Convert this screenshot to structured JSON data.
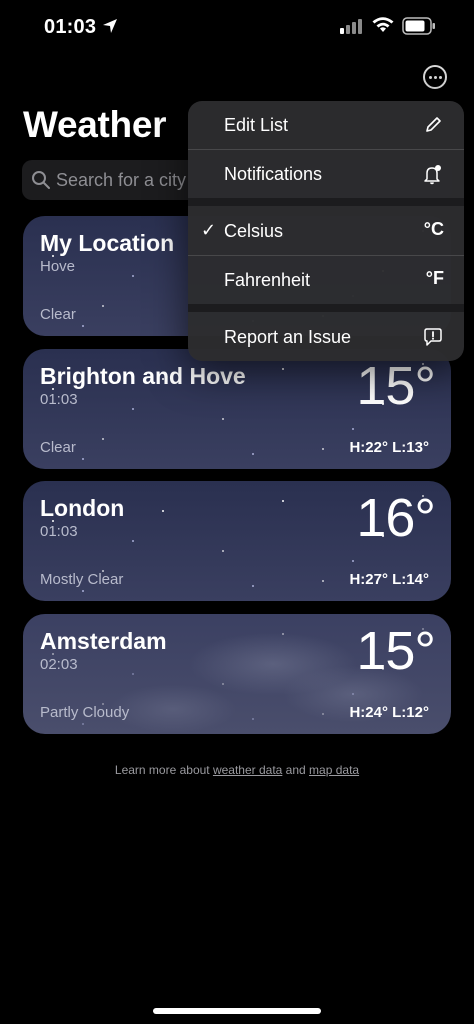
{
  "status_bar": {
    "time": "01:03"
  },
  "header": {
    "title": "Weather"
  },
  "search": {
    "placeholder": "Search for a city"
  },
  "cards": [
    {
      "city": "My Location",
      "subtitle": "Hove",
      "condition": "Clear",
      "temp": "",
      "hilo": ""
    },
    {
      "city": "Brighton and Hove",
      "subtitle": "01:03",
      "condition": "Clear",
      "temp": "15°",
      "hilo": "H:22°  L:13°"
    },
    {
      "city": "London",
      "subtitle": "01:03",
      "condition": "Mostly Clear",
      "temp": "16°",
      "hilo": "H:27°  L:14°"
    },
    {
      "city": "Amsterdam",
      "subtitle": "02:03",
      "condition": "Partly Cloudy",
      "temp": "15°",
      "hilo": "H:24°  L:12°"
    }
  ],
  "footer": {
    "prefix": "Learn more about ",
    "link1": "weather data",
    "middle": " and ",
    "link2": "map data"
  },
  "menu": {
    "edit_list": "Edit List",
    "notifications": "Notifications",
    "celsius": "Celsius",
    "celsius_symbol": "°C",
    "celsius_checkmark": "✓",
    "fahrenheit": "Fahrenheit",
    "fahrenheit_symbol": "°F",
    "report_issue": "Report an Issue"
  },
  "icons": {
    "location": "location-arrow-icon",
    "signal": "cellular-signal-icon",
    "wifi": "wifi-icon",
    "battery": "battery-icon",
    "more": "ellipsis-circle-icon",
    "search": "magnifying-glass-icon",
    "pencil": "pencil-icon",
    "bell": "bell-badge-icon",
    "report": "exclamation-bubble-icon"
  }
}
